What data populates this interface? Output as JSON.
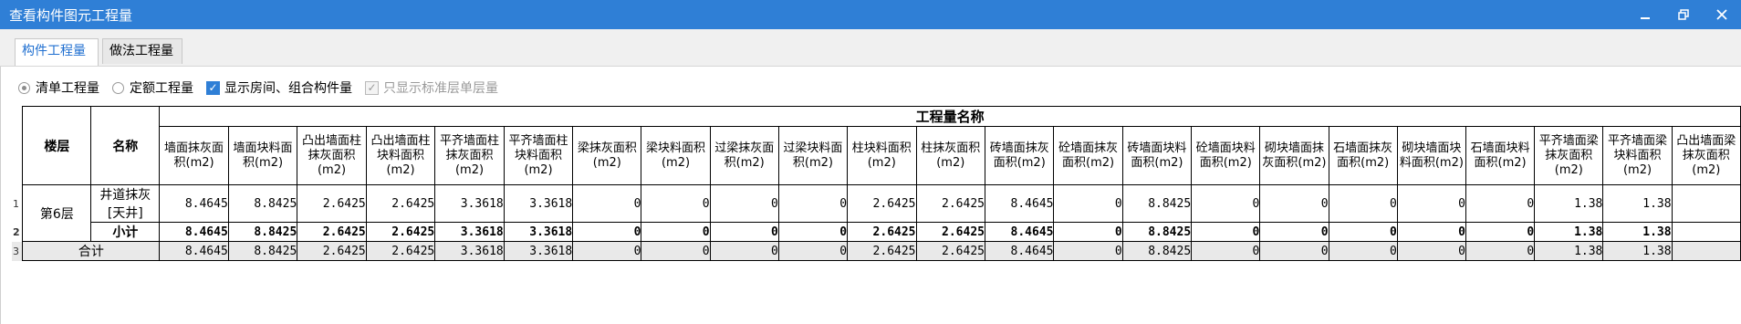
{
  "window": {
    "title": "查看构件图元工程量",
    "controls": [
      "minimize-icon",
      "restore-icon",
      "close-icon"
    ]
  },
  "tabs": [
    {
      "label": "构件工程量",
      "active": true
    },
    {
      "label": "做法工程量",
      "active": false
    }
  ],
  "options": {
    "radio_list": "清单工程量",
    "radio_quota": "定额工程量",
    "cb_show_room": "显示房间、组合构件量",
    "cb_std_floor": "只显示标准层单层量"
  },
  "grid": {
    "group_header": "工程量名称",
    "floor_header": "楼层",
    "name_header": "名称",
    "columns": [
      "墙面抹灰面积(m2)",
      "墙面块料面积(m2)",
      "凸出墙面柱抹灰面积(m2)",
      "凸出墙面柱块料面积(m2)",
      "平齐墙面柱抹灰面积(m2)",
      "平齐墙面柱块料面积(m2)",
      "梁抹灰面积(m2)",
      "梁块料面积(m2)",
      "过梁抹灰面积(m2)",
      "过梁块料面积(m2)",
      "柱块料面积(m2)",
      "柱抹灰面积(m2)",
      "砖墙面抹灰面积(m2)",
      "砼墙面抹灰面积(m2)",
      "砖墙面块料面积(m2)",
      "砼墙面块料面积(m2)",
      "砌块墙面抹灰面积(m2)",
      "石墙面抹灰面积(m2)",
      "砌块墙面块料面积(m2)",
      "石墙面块料面积(m2)",
      "平齐墙面梁抹灰面积(m2)",
      "平齐墙面梁块料面积(m2)",
      "凸出墙面梁抹灰面积(m2)"
    ],
    "rows": [
      {
        "row_num": "1",
        "floor": "第6层",
        "name": "井道抹灰[天井]",
        "values": [
          "8.4645",
          "8.8425",
          "2.6425",
          "2.6425",
          "3.3618",
          "3.3618",
          "0",
          "0",
          "0",
          "0",
          "2.6425",
          "2.6425",
          "8.4645",
          "0",
          "8.8425",
          "0",
          "0",
          "0",
          "0",
          "0",
          "1.38",
          "1.38",
          ""
        ]
      },
      {
        "row_num": "2",
        "name": "小计",
        "values": [
          "8.4645",
          "8.8425",
          "2.6425",
          "2.6425",
          "3.3618",
          "3.3618",
          "0",
          "0",
          "0",
          "0",
          "2.6425",
          "2.6425",
          "8.4645",
          "0",
          "8.8425",
          "0",
          "0",
          "0",
          "0",
          "0",
          "1.38",
          "1.38",
          ""
        ]
      },
      {
        "row_num": "3",
        "name": "合计",
        "values": [
          "8.4645",
          "8.8425",
          "2.6425",
          "2.6425",
          "3.3618",
          "3.3618",
          "0",
          "0",
          "0",
          "0",
          "2.6425",
          "2.6425",
          "8.4645",
          "0",
          "8.8425",
          "0",
          "0",
          "0",
          "0",
          "0",
          "1.38",
          "1.38",
          ""
        ]
      }
    ]
  }
}
